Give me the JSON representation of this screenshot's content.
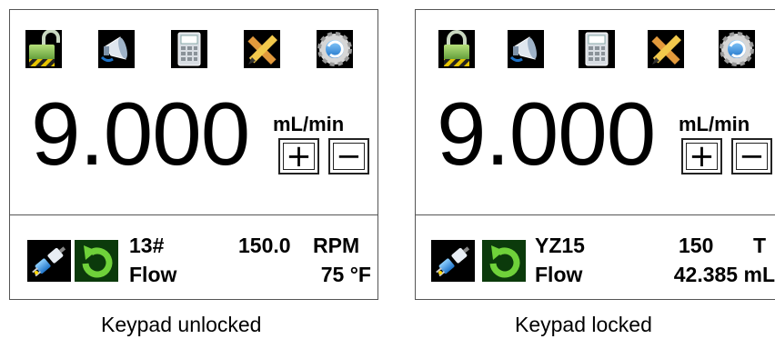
{
  "left": {
    "reading": "9.000",
    "unit": "mL/min",
    "plus_label": "+",
    "minus_label": "−",
    "channel": "13#",
    "mode": "Flow",
    "rpm_value": "150.0",
    "rpm_unit": "RPM",
    "temperature": "75 °F",
    "caption": "Keypad unlocked"
  },
  "right": {
    "reading": "9.000",
    "unit": "mL/min",
    "plus_label": "+",
    "minus_label": "−",
    "channel": "YZ15",
    "mode": "Flow",
    "value_top": "150",
    "value_top_unit": "T",
    "volume": "42.385 mL",
    "caption": "Keypad locked"
  },
  "icons": [
    "lock-icon",
    "announcement-icon",
    "keypad-icon",
    "tools-icon",
    "settings-icon",
    "plug-icon",
    "cycle-icon"
  ],
  "colors": {
    "lock_green": "#6fae3a",
    "settings_blue": "#1e73c8",
    "border": "#555555"
  }
}
